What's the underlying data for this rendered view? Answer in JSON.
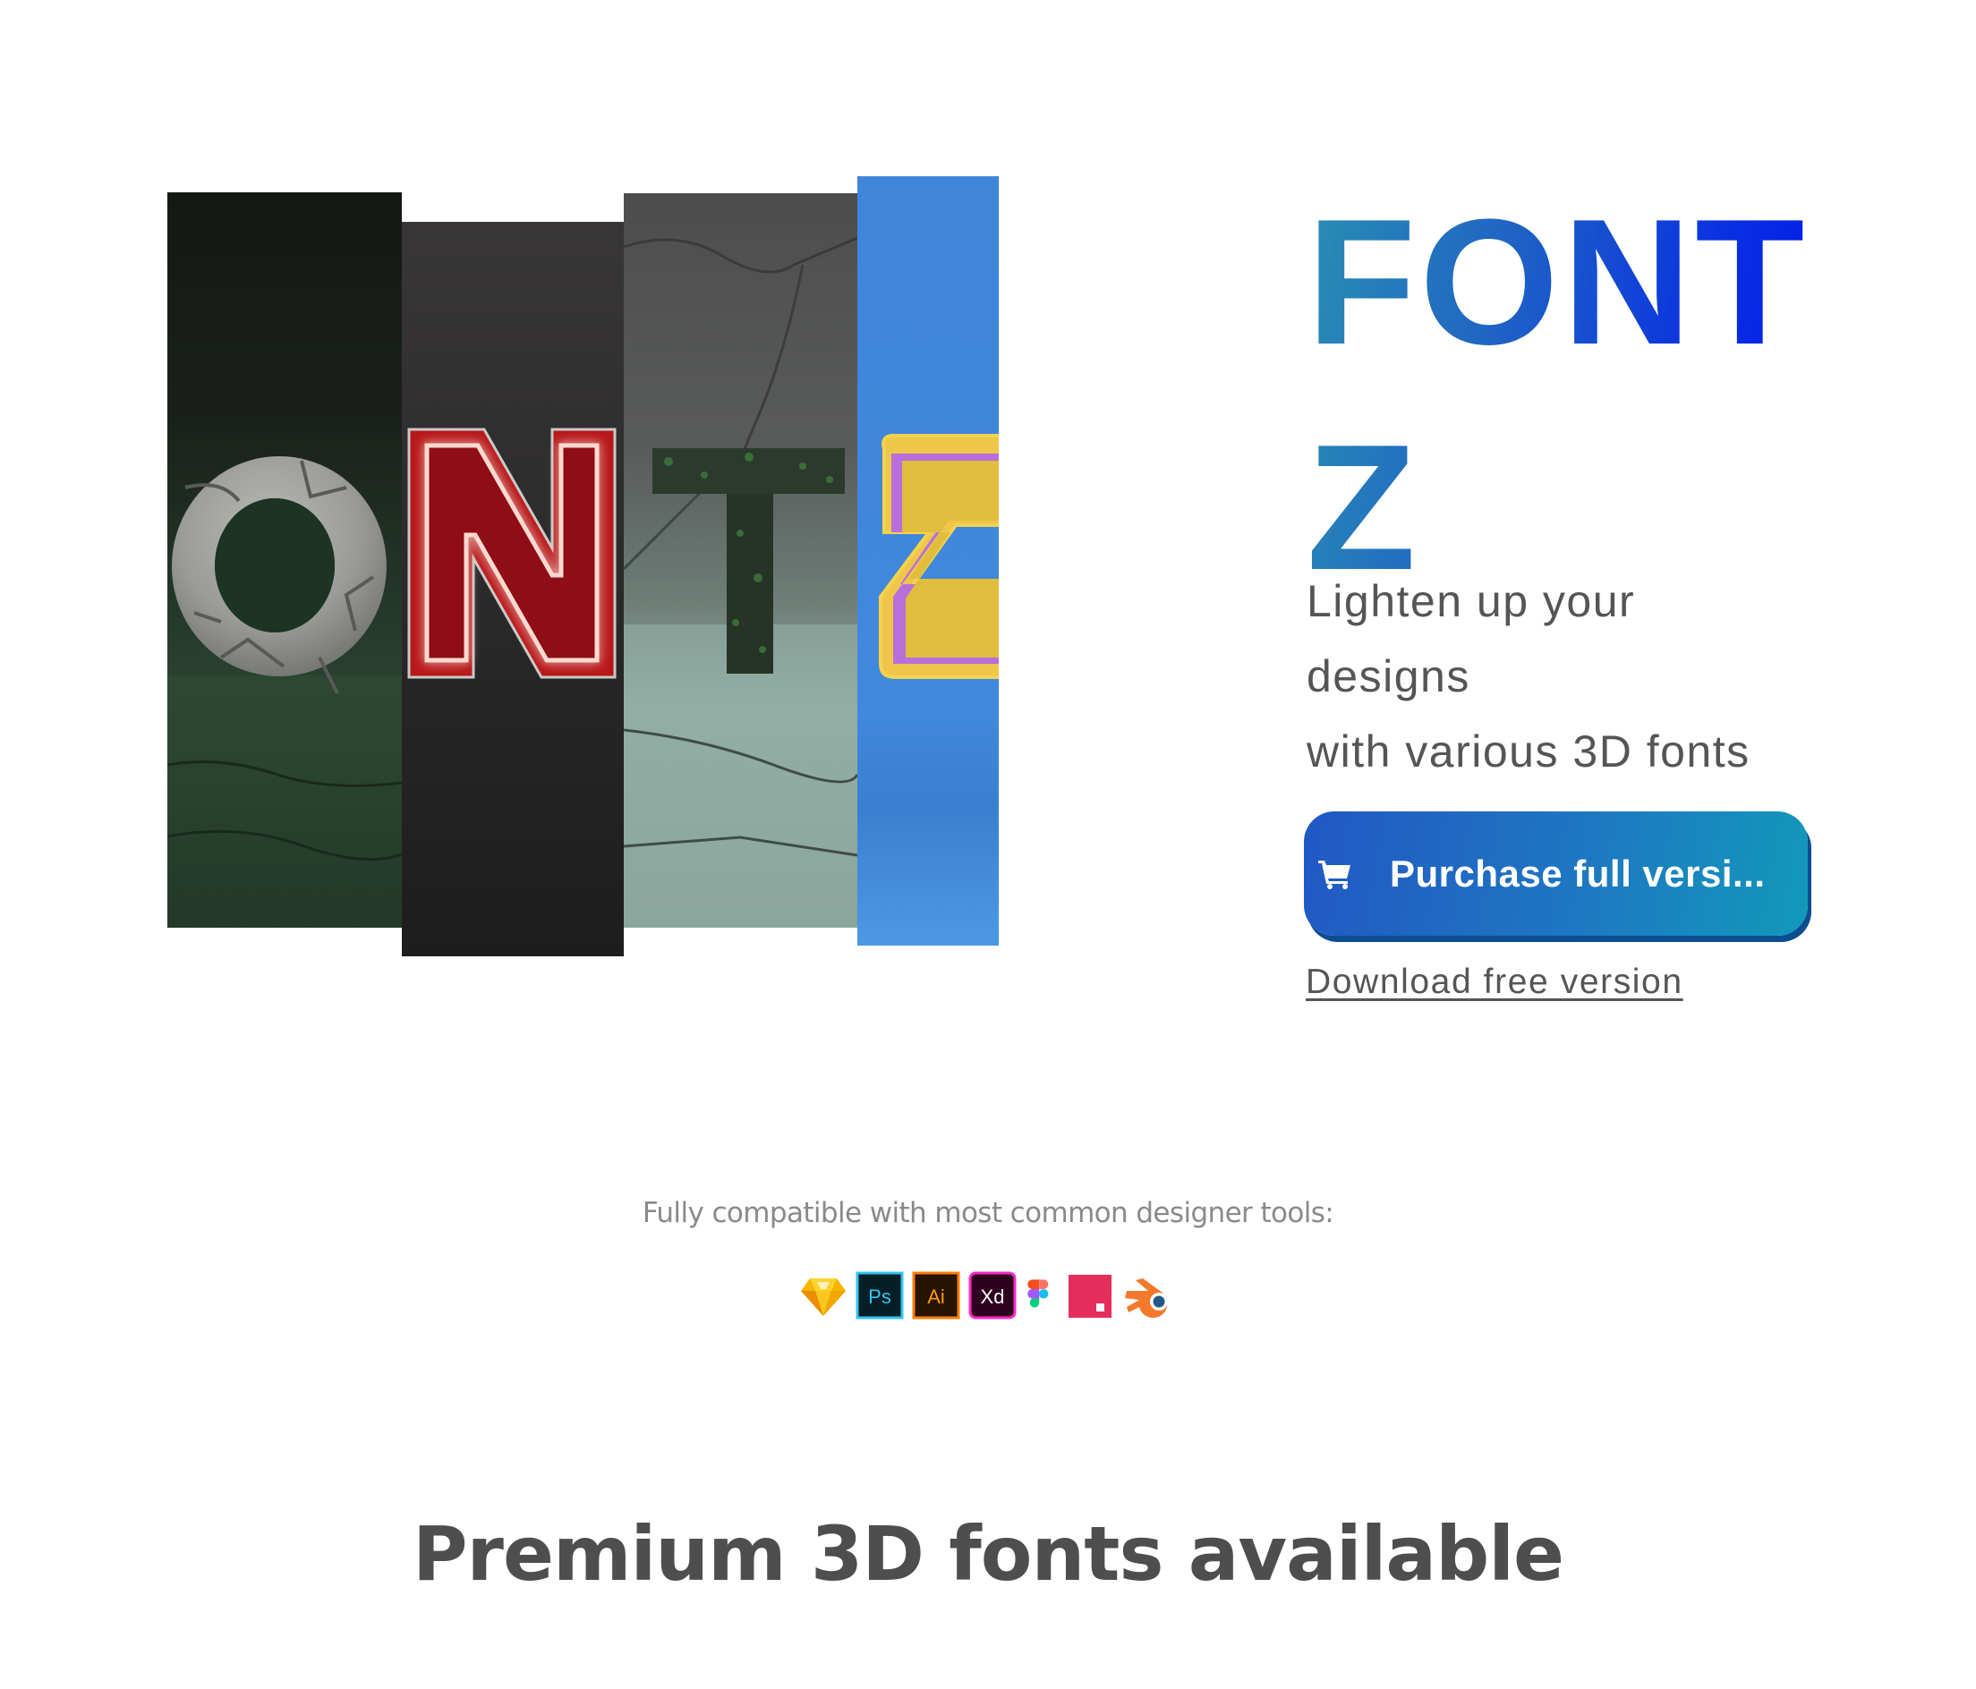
{
  "hero": {
    "collage": {
      "letters": [
        "O",
        "N",
        "T",
        "Z"
      ],
      "styles": [
        "cracked-stone",
        "neon-red",
        "mossy-rock",
        "inflated-yellow"
      ]
    },
    "brand": {
      "line1": "FONT",
      "line2": "Z",
      "gradient_colors": [
        "#2a8fb3",
        "#0016ef"
      ]
    },
    "tagline": {
      "line1": "Lighten up your",
      "line2": "designs",
      "line3": "with various 3D fonts"
    },
    "purchase_button": {
      "label": "Purchase full versi...",
      "icon": "shopping-cart-icon",
      "colors": [
        "#2158c4",
        "#1299bb"
      ]
    },
    "download_link": {
      "label": "Download free version"
    }
  },
  "compatibility": {
    "text": "Fully compatible with most common designer tools:",
    "tools": [
      {
        "name": "Sketch",
        "icon": "sketch-icon"
      },
      {
        "name": "Ps",
        "icon": "photoshop-icon"
      },
      {
        "name": "Ai",
        "icon": "illustrator-icon"
      },
      {
        "name": "Xd",
        "icon": "xd-icon"
      },
      {
        "name": "Figma",
        "icon": "figma-icon"
      },
      {
        "name": "InVision",
        "icon": "invision-icon"
      },
      {
        "name": "Blender",
        "icon": "blender-icon"
      }
    ]
  },
  "section": {
    "heading": "Premium 3D fonts available"
  }
}
